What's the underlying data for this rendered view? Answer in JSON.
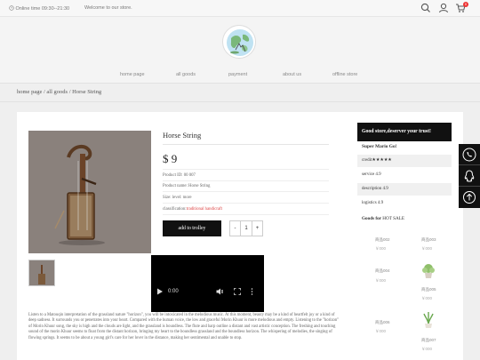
{
  "topbar": {
    "hours": "Online time 09:30--21:30",
    "welcome": "Welcome to our store.",
    "cart_count": "0"
  },
  "header": {
    "logo_icon": "globe-logo-icon"
  },
  "nav": [
    "home page",
    "all goods",
    "payment",
    "about us",
    "offline store"
  ],
  "breadcrumb": {
    "home": "home page",
    "sep": "/",
    "category": "all goods",
    "current": "Horse String"
  },
  "product": {
    "title": "Horse String",
    "currency": "$",
    "price": "9",
    "product_id": "Product ID: 00 007",
    "product_name": "Product name: Horse String",
    "size": "Size: level: more",
    "classification_label": "classification:",
    "classification_value": "traditional handicraft",
    "add_button": "add to trolley",
    "qty_minus": "-",
    "qty_value": "1",
    "qty_plus": "+"
  },
  "video": {
    "time": "0:00"
  },
  "description": "Listen to a Matouqin interpretation of the grassland nature \"horizon\", you will be intoxicated in the melodious music. At this moment, beauty may be a kind of heartfelt joy or a kind of deep sadness. It surrounds you or penetrates into your heart. Compared with the human voice, the low and graceful Morin Khuur is more melodious and empty. Listening to the \"horizon\" of Morin Khuur song, the sky is high and the clouds are light, and the grassland is boundless. The flute and harp outline a distant and vast artistic conception. The freshing and touching sound of the morin Khuur seems to float from the distant horizon, bringing my heart to the boundless grassland and the boundless horizon. The whispering of melodies, the singing of flowing springs. It seems to be about a young girl's care for her lover in the distance, making her sentimental and unable to stop.",
  "sidebar": {
    "header": "Good store,deserver your trust!",
    "store_name": "Super Mario Go!",
    "stats": [
      "credit★★★★★",
      "service 4.9",
      "description 4.9",
      "logistics 4.9"
    ],
    "goods_label": "Goods for",
    "goods_sub": "HOT SALE",
    "goods": [
      {
        "name": "商品002",
        "price": "￥000"
      },
      {
        "name": "商品003",
        "price": "￥000"
      },
      {
        "name": "商品004",
        "price": "￥000"
      },
      {
        "name": "商品005",
        "price": "￥000"
      },
      {
        "name": "商品006",
        "price": "￥000"
      },
      {
        "name": "商品007",
        "price": "￥000"
      }
    ]
  },
  "float_buttons": [
    "phone-icon",
    "qq-icon",
    "back-to-top-icon"
  ],
  "colors": {
    "accent": "#111111",
    "highlight": "#dd4444",
    "background": "#efefef"
  }
}
